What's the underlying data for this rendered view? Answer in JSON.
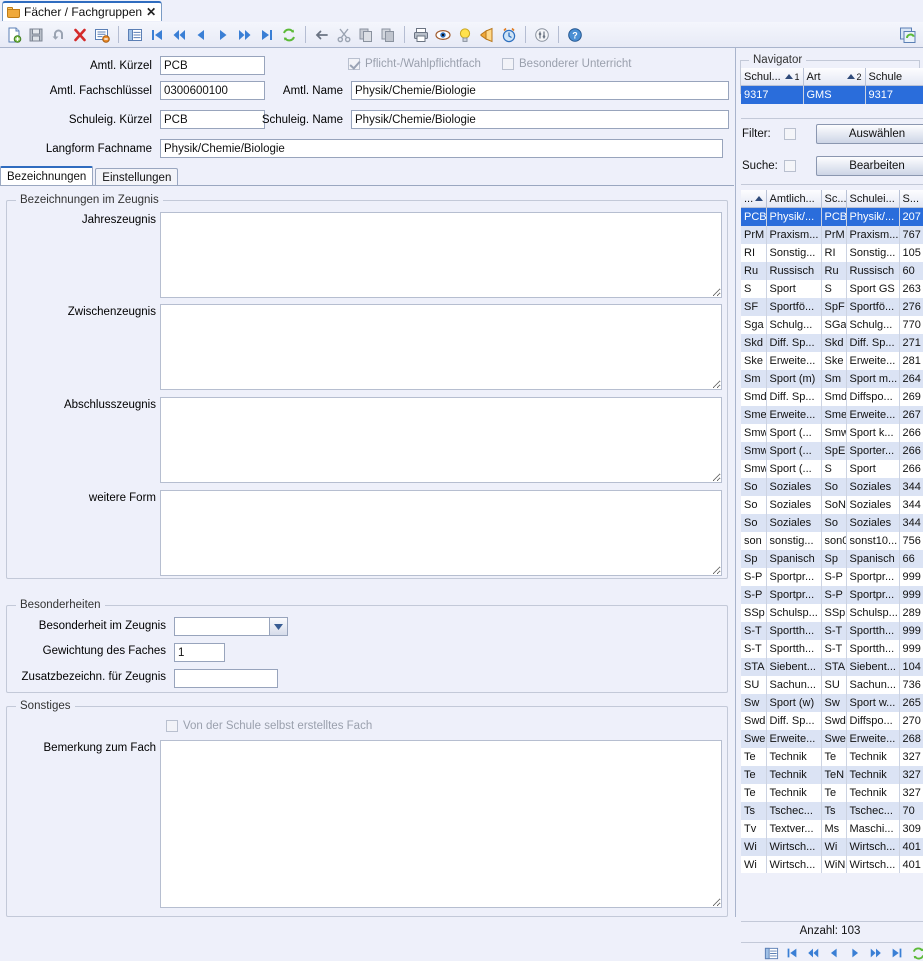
{
  "window": {
    "tab_title": "Fächer / Fachgruppen",
    "tab_close": "✕",
    "folder_icon": "folder-icon"
  },
  "toolbar": {
    "buttons": [
      {
        "name": "new-document-button",
        "icon": "new-document-icon"
      },
      {
        "name": "save-button",
        "icon": "save-disk-icon"
      },
      {
        "name": "undo-button",
        "icon": "undo-arrow-icon"
      },
      {
        "name": "delete-button",
        "icon": "red-x-icon"
      },
      {
        "name": "edit-record-button",
        "icon": "form-edit-icon"
      },
      {
        "name": "list-view-button",
        "icon": "table-list-icon"
      },
      {
        "name": "first-record-button",
        "icon": "skip-first-icon"
      },
      {
        "name": "fast-back-button",
        "icon": "rewind-icon"
      },
      {
        "name": "previous-record-button",
        "icon": "triangle-left-icon"
      },
      {
        "name": "next-record-button",
        "icon": "triangle-right-icon"
      },
      {
        "name": "fast-forward-button",
        "icon": "fast-forward-icon"
      },
      {
        "name": "last-record-button",
        "icon": "skip-last-icon"
      },
      {
        "name": "refresh-button",
        "icon": "green-refresh-icon"
      },
      {
        "name": "back-button",
        "icon": "left-arrow-icon"
      },
      {
        "name": "cut-button",
        "icon": "scissors-icon"
      },
      {
        "name": "copy-button",
        "icon": "copy-pages-icon"
      },
      {
        "name": "paste-button",
        "icon": "paste-pages-icon"
      },
      {
        "name": "print-button",
        "icon": "printer-icon"
      },
      {
        "name": "preview-button",
        "icon": "eye-icon"
      },
      {
        "name": "hint-button",
        "icon": "lightbulb-icon"
      },
      {
        "name": "notify-button",
        "icon": "megaphone-icon"
      },
      {
        "name": "reminder-button",
        "icon": "alarm-clock-icon"
      },
      {
        "name": "settings-button",
        "icon": "sliders-icon"
      },
      {
        "name": "help-button",
        "icon": "question-help-icon"
      }
    ],
    "right_button": {
      "name": "duplicate-refresh-button",
      "icon": "green-duplicate-icon"
    }
  },
  "form": {
    "fields": {
      "amtl_kuerzel_label": "Amtl. Kürzel",
      "amtl_kuerzel_value": "PCB",
      "amtl_fachschluessel_label": "Amtl.  Fachschlüssel",
      "amtl_fachschluessel_value": "0300600100",
      "amtl_name_label": "Amtl. Name",
      "amtl_name_value": "Physik/Chemie/Biologie",
      "schuleig_kuerzel_label": "Schuleig. Kürzel",
      "schuleig_kuerzel_value": "PCB",
      "schuleig_name_label": "Schuleig. Name",
      "schuleig_name_value": "Physik/Chemie/Biologie",
      "langform_label": "Langform Fachname",
      "langform_value": "Physik/Chemie/Biologie"
    },
    "checkboxes": {
      "pflicht_label": "Pflicht-/Wahlpflichtfach",
      "pflicht_checked": true,
      "besonderer_label": "Besonderer Unterricht",
      "besonderer_checked": false
    },
    "tabs": [
      {
        "label": "Bezeichnungen",
        "active": true
      },
      {
        "label": "Einstellungen",
        "active": false
      }
    ],
    "group_bezeichnungen": {
      "title": "Bezeichnungen im Zeugnis",
      "items": [
        {
          "label": "Jahreszeugnis",
          "value": ""
        },
        {
          "label": "Zwischenzeugnis",
          "value": ""
        },
        {
          "label": "Abschlusszeugnis",
          "value": ""
        },
        {
          "label": "weitere Form",
          "value": ""
        }
      ]
    },
    "group_besonderheiten": {
      "title": "Besonderheiten",
      "besonderheit_label": "Besonderheit im Zeugnis",
      "besonderheit_value": "",
      "gewichtung_label": "Gewichtung des Faches",
      "gewichtung_value": "1",
      "zusatz_label": "Zusatzbezeichn. für Zeugnis",
      "zusatz_value": ""
    },
    "group_sonstiges": {
      "title": "Sonstiges",
      "selbst_erstellt_label": "Von der Schule selbst erstelltes Fach",
      "selbst_erstellt_checked": false,
      "bemerkung_label": "Bemerkung zum Fach",
      "bemerkung_value": ""
    }
  },
  "navigator": {
    "title": "Navigator",
    "school_table": {
      "headers": [
        {
          "label": "Schul...",
          "sort": "asc",
          "sort_order": "1"
        },
        {
          "label": "Art",
          "sort": "asc",
          "sort_order": "2"
        },
        {
          "label": "Schule",
          "sort": "",
          "sort_order": ""
        }
      ],
      "rows": [
        {
          "selected": true,
          "cells": [
            "9317",
            "GMS",
            "9317"
          ]
        }
      ]
    },
    "filter_label": "Filter:",
    "filter_checked": false,
    "suche_label": "Suche:",
    "suche_checked": false,
    "auswaehlen_button": "Auswählen",
    "bearbeiten_button": "Bearbeiten",
    "grid": {
      "headers": [
        {
          "label": "...",
          "sort": "asc"
        },
        {
          "label": "Amtlich...",
          "sort": ""
        },
        {
          "label": "Sc...",
          "sort": ""
        },
        {
          "label": "Schulei...",
          "sort": ""
        },
        {
          "label": "S...",
          "sort": ""
        }
      ],
      "rows": [
        {
          "selected": true,
          "cells": [
            "PCB",
            "Physik/...",
            "PCB",
            "Physik/...",
            "207"
          ]
        },
        {
          "selected": false,
          "cells": [
            "PrM",
            "Praxism...",
            "PrM",
            "Praxism...",
            "767"
          ]
        },
        {
          "selected": false,
          "cells": [
            "RI",
            "Sonstig...",
            "RI",
            "Sonstig...",
            "105"
          ]
        },
        {
          "selected": false,
          "cells": [
            "Ru",
            "Russisch",
            "Ru",
            "Russisch",
            "60"
          ]
        },
        {
          "selected": false,
          "cells": [
            "S",
            "Sport",
            "S",
            "Sport GS",
            "263"
          ]
        },
        {
          "selected": false,
          "cells": [
            "SF",
            "Sportfö...",
            "SpF",
            "Sportfö...",
            "276"
          ]
        },
        {
          "selected": false,
          "cells": [
            "Sga",
            "Schulg...",
            "SGa",
            "Schulg...",
            "770"
          ]
        },
        {
          "selected": false,
          "cells": [
            "Skd",
            "Diff. Sp...",
            "Skd",
            "Diff. Sp...",
            "271"
          ]
        },
        {
          "selected": false,
          "cells": [
            "Ske",
            "Erweite...",
            "Ske",
            "Erweite...",
            "281"
          ]
        },
        {
          "selected": false,
          "cells": [
            "Sm",
            "Sport (m)",
            "Sm",
            "Sport m...",
            "264"
          ]
        },
        {
          "selected": false,
          "cells": [
            "Smd",
            "Diff. Sp...",
            "Smd",
            "Diffspo...",
            "269"
          ]
        },
        {
          "selected": false,
          "cells": [
            "Sme",
            "Erweite...",
            "Sme",
            "Erweite...",
            "267"
          ]
        },
        {
          "selected": false,
          "cells": [
            "Smw",
            "Sport (...",
            "Smw",
            "Sport k...",
            "266"
          ]
        },
        {
          "selected": false,
          "cells": [
            "Smw",
            "Sport (...",
            "SpE",
            "Sporter...",
            "266"
          ]
        },
        {
          "selected": false,
          "cells": [
            "Smw",
            "Sport (...",
            "S",
            "Sport",
            "266"
          ]
        },
        {
          "selected": false,
          "cells": [
            "So",
            "Soziales",
            "So",
            "Soziales",
            "344"
          ]
        },
        {
          "selected": false,
          "cells": [
            "So",
            "Soziales",
            "SoN",
            "Soziales",
            "344"
          ]
        },
        {
          "selected": false,
          "cells": [
            "So",
            "Soziales",
            "So",
            "Soziales",
            "344"
          ]
        },
        {
          "selected": false,
          "cells": [
            "son",
            "sonstig...",
            "son0",
            "sonst10...",
            "756"
          ]
        },
        {
          "selected": false,
          "cells": [
            "Sp",
            "Spanisch",
            "Sp",
            "Spanisch",
            "66"
          ]
        },
        {
          "selected": false,
          "cells": [
            "S-P",
            "Sportpr...",
            "S-P",
            "Sportpr...",
            "999"
          ]
        },
        {
          "selected": false,
          "cells": [
            "S-P",
            "Sportpr...",
            "S-P",
            "Sportpr...",
            "999"
          ]
        },
        {
          "selected": false,
          "cells": [
            "SSp",
            "Schulsp...",
            "SSp",
            "Schulsp...",
            "289"
          ]
        },
        {
          "selected": false,
          "cells": [
            "S-T",
            "Sportth...",
            "S-T",
            "Sportth...",
            "999"
          ]
        },
        {
          "selected": false,
          "cells": [
            "S-T",
            "Sportth...",
            "S-T",
            "Sportth...",
            "999"
          ]
        },
        {
          "selected": false,
          "cells": [
            "STA",
            "Siebent...",
            "STA",
            "Siebent...",
            "104"
          ]
        },
        {
          "selected": false,
          "cells": [
            "SU",
            "Sachun...",
            "SU",
            "Sachun...",
            "736"
          ]
        },
        {
          "selected": false,
          "cells": [
            "Sw",
            "Sport (w)",
            "Sw",
            "Sport w...",
            "265"
          ]
        },
        {
          "selected": false,
          "cells": [
            "Swd",
            "Diff. Sp...",
            "Swd",
            "Diffspo...",
            "270"
          ]
        },
        {
          "selected": false,
          "cells": [
            "Swe",
            "Erweite...",
            "Swe",
            "Erweite...",
            "268"
          ]
        },
        {
          "selected": false,
          "cells": [
            "Te",
            "Technik",
            "Te",
            "Technik",
            "327"
          ]
        },
        {
          "selected": false,
          "cells": [
            "Te",
            "Technik",
            "TeN",
            "Technik",
            "327"
          ]
        },
        {
          "selected": false,
          "cells": [
            "Te",
            "Technik",
            "Te",
            "Technik",
            "327"
          ]
        },
        {
          "selected": false,
          "cells": [
            "Ts",
            "Tschec...",
            "Ts",
            "Tschec...",
            "70"
          ]
        },
        {
          "selected": false,
          "cells": [
            "Tv",
            "Textver...",
            "Ms",
            "Maschi...",
            "309"
          ]
        },
        {
          "selected": false,
          "cells": [
            "Wi",
            "Wirtsch...",
            "Wi",
            "Wirtsch...",
            "401"
          ]
        },
        {
          "selected": false,
          "cells": [
            "Wi",
            "Wirtsch...",
            "WiN",
            "Wirtsch...",
            "401"
          ]
        }
      ]
    },
    "count_label": "Anzahl: 103",
    "footer_buttons": [
      {
        "name": "nav-list-view-button",
        "icon": "table-list-icon"
      },
      {
        "name": "nav-first-button",
        "icon": "skip-first-icon"
      },
      {
        "name": "nav-fast-back-button",
        "icon": "rewind-icon"
      },
      {
        "name": "nav-previous-button",
        "icon": "triangle-left-icon"
      },
      {
        "name": "nav-next-button",
        "icon": "triangle-right-icon"
      },
      {
        "name": "nav-fast-forward-button",
        "icon": "fast-forward-icon"
      },
      {
        "name": "nav-last-button",
        "icon": "skip-last-icon"
      },
      {
        "name": "nav-refresh-button",
        "icon": "green-refresh-icon"
      }
    ]
  },
  "colors": {
    "background": "#eef0fa",
    "selection": "#2a6ddb",
    "alt_row": "#dbe3f4",
    "accent": "#2f6cbf"
  }
}
